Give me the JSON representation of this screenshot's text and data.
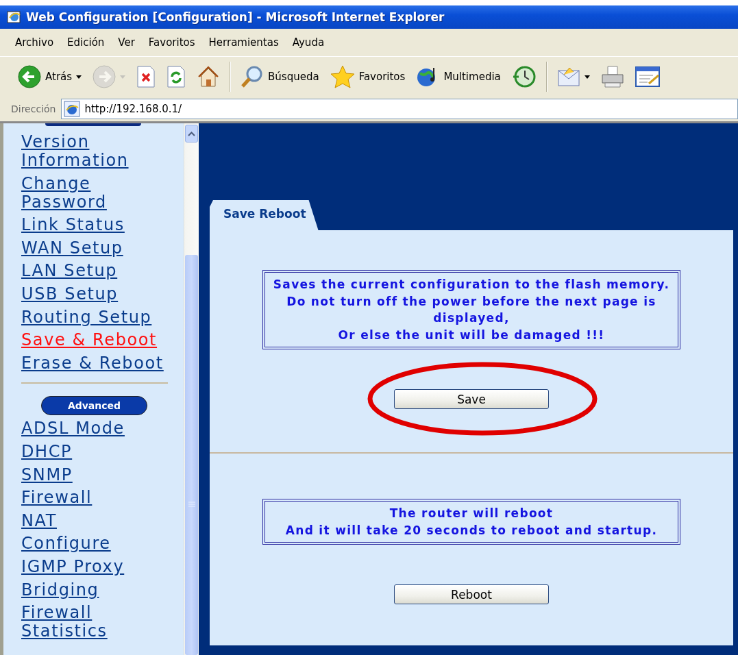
{
  "window": {
    "title": "Web Configuration [Configuration] - Microsoft Internet Explorer"
  },
  "menu": [
    "Archivo",
    "Edición",
    "Ver",
    "Favoritos",
    "Herramientas",
    "Ayuda"
  ],
  "toolbar": [
    {
      "kind": "back",
      "label": "Atrás",
      "dropdown": true,
      "disabled": false
    },
    {
      "kind": "forward",
      "dropdown": true,
      "disabled": true
    },
    {
      "kind": "stop",
      "disabled": false
    },
    {
      "kind": "refresh",
      "disabled": false
    },
    {
      "kind": "home",
      "disabled": false
    },
    {
      "kind": "separator"
    },
    {
      "kind": "search",
      "label": "Búsqueda",
      "disabled": false
    },
    {
      "kind": "favorites",
      "label": "Favoritos",
      "disabled": false
    },
    {
      "kind": "media",
      "label": "Multimedia",
      "disabled": false
    },
    {
      "kind": "history",
      "disabled": false
    },
    {
      "kind": "separator"
    },
    {
      "kind": "mail",
      "dropdown": true,
      "disabled": false
    },
    {
      "kind": "print",
      "disabled": false
    },
    {
      "kind": "edit",
      "disabled": false
    }
  ],
  "address": {
    "label": "Dirección",
    "value": "http://192.168.0.1/"
  },
  "sidebar": {
    "sections": [
      {
        "items": [
          {
            "label": "Version Information",
            "selected": false
          },
          {
            "label": "Change Password",
            "selected": false
          },
          {
            "label": "Link Status",
            "selected": false
          },
          {
            "label": "WAN Setup",
            "selected": false
          },
          {
            "label": "LAN Setup",
            "selected": false
          },
          {
            "label": "USB Setup",
            "selected": false
          },
          {
            "label": "Routing Setup",
            "selected": false
          },
          {
            "label": "Save & Reboot",
            "selected": true
          },
          {
            "label": "Erase & Reboot",
            "selected": false
          }
        ]
      },
      {
        "header": "Advanced",
        "items": [
          {
            "label": "ADSL Mode",
            "selected": false
          },
          {
            "label": "DHCP",
            "selected": false
          },
          {
            "label": "SNMP",
            "selected": false
          },
          {
            "label": "Firewall",
            "selected": false
          },
          {
            "label": "NAT",
            "selected": false
          },
          {
            "label": "Configure",
            "selected": false
          },
          {
            "label": "IGMP Proxy",
            "selected": false
          },
          {
            "label": "Bridging",
            "selected": false
          },
          {
            "label": "Firewall Statistics",
            "selected": false
          }
        ]
      }
    ]
  },
  "panel": {
    "tab": "Save Reboot",
    "sections": [
      {
        "message": [
          "Saves the current configuration to the flash memory.",
          "Do not turn off the power before the next page is displayed,",
          "Or else the unit will be damaged !!!"
        ],
        "button": "Save",
        "highlighted": true
      },
      {
        "message": [
          "The router will reboot",
          "And it will take 20 seconds to reboot and startup."
        ],
        "button": "Reboot",
        "highlighted": false
      }
    ]
  }
}
